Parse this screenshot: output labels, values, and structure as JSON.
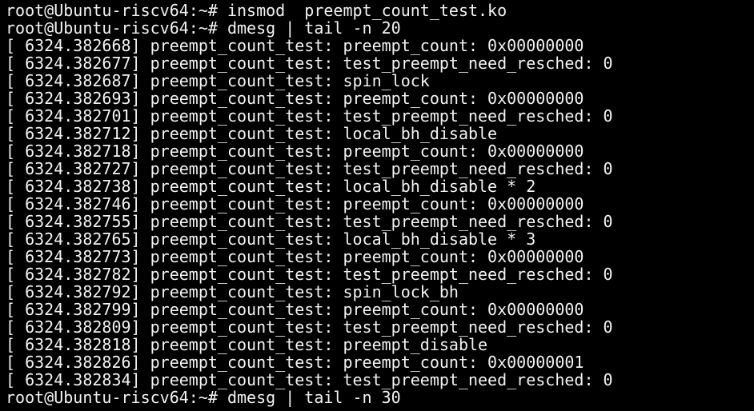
{
  "prompt": "root@Ubuntu-riscv64:~# ",
  "commands": {
    "insmod": "insmod  preempt_count_test.ko",
    "dmesg": "dmesg | tail -n 20",
    "dmesg_next": "dmesg | tail -n 30"
  },
  "log": [
    {
      "ts": "[ 6324.382668]",
      "msg": "preempt_count_test: preempt_count: 0x00000000"
    },
    {
      "ts": "[ 6324.382677]",
      "msg": "preempt_count_test: test_preempt_need_resched: 0"
    },
    {
      "ts": "[ 6324.382687]",
      "msg": "preempt_count_test: spin_lock"
    },
    {
      "ts": "[ 6324.382693]",
      "msg": "preempt_count_test: preempt_count: 0x00000000"
    },
    {
      "ts": "[ 6324.382701]",
      "msg": "preempt_count_test: test_preempt_need_resched: 0"
    },
    {
      "ts": "[ 6324.382712]",
      "msg": "preempt_count_test: local_bh_disable"
    },
    {
      "ts": "[ 6324.382718]",
      "msg": "preempt_count_test: preempt_count: 0x00000000"
    },
    {
      "ts": "[ 6324.382727]",
      "msg": "preempt_count_test: test_preempt_need_resched: 0"
    },
    {
      "ts": "[ 6324.382738]",
      "msg": "preempt_count_test: local_bh_disable * 2"
    },
    {
      "ts": "[ 6324.382746]",
      "msg": "preempt_count_test: preempt_count: 0x00000000"
    },
    {
      "ts": "[ 6324.382755]",
      "msg": "preempt_count_test: test_preempt_need_resched: 0"
    },
    {
      "ts": "[ 6324.382765]",
      "msg": "preempt_count_test: local_bh_disable * 3"
    },
    {
      "ts": "[ 6324.382773]",
      "msg": "preempt_count_test: preempt_count: 0x00000000"
    },
    {
      "ts": "[ 6324.382782]",
      "msg": "preempt_count_test: test_preempt_need_resched: 0"
    },
    {
      "ts": "[ 6324.382792]",
      "msg": "preempt_count_test: spin_lock_bh"
    },
    {
      "ts": "[ 6324.382799]",
      "msg": "preempt_count_test: preempt_count: 0x00000000"
    },
    {
      "ts": "[ 6324.382809]",
      "msg": "preempt_count_test: test_preempt_need_resched: 0"
    },
    {
      "ts": "[ 6324.382818]",
      "msg": "preempt_count_test: preempt_disable"
    },
    {
      "ts": "[ 6324.382826]",
      "msg": "preempt_count_test: preempt_count: 0x00000001"
    },
    {
      "ts": "[ 6324.382834]",
      "msg": "preempt_count_test: test_preempt_need_resched: 0"
    }
  ],
  "colors": {
    "background": "#000000",
    "text": "#f2f2f2"
  }
}
